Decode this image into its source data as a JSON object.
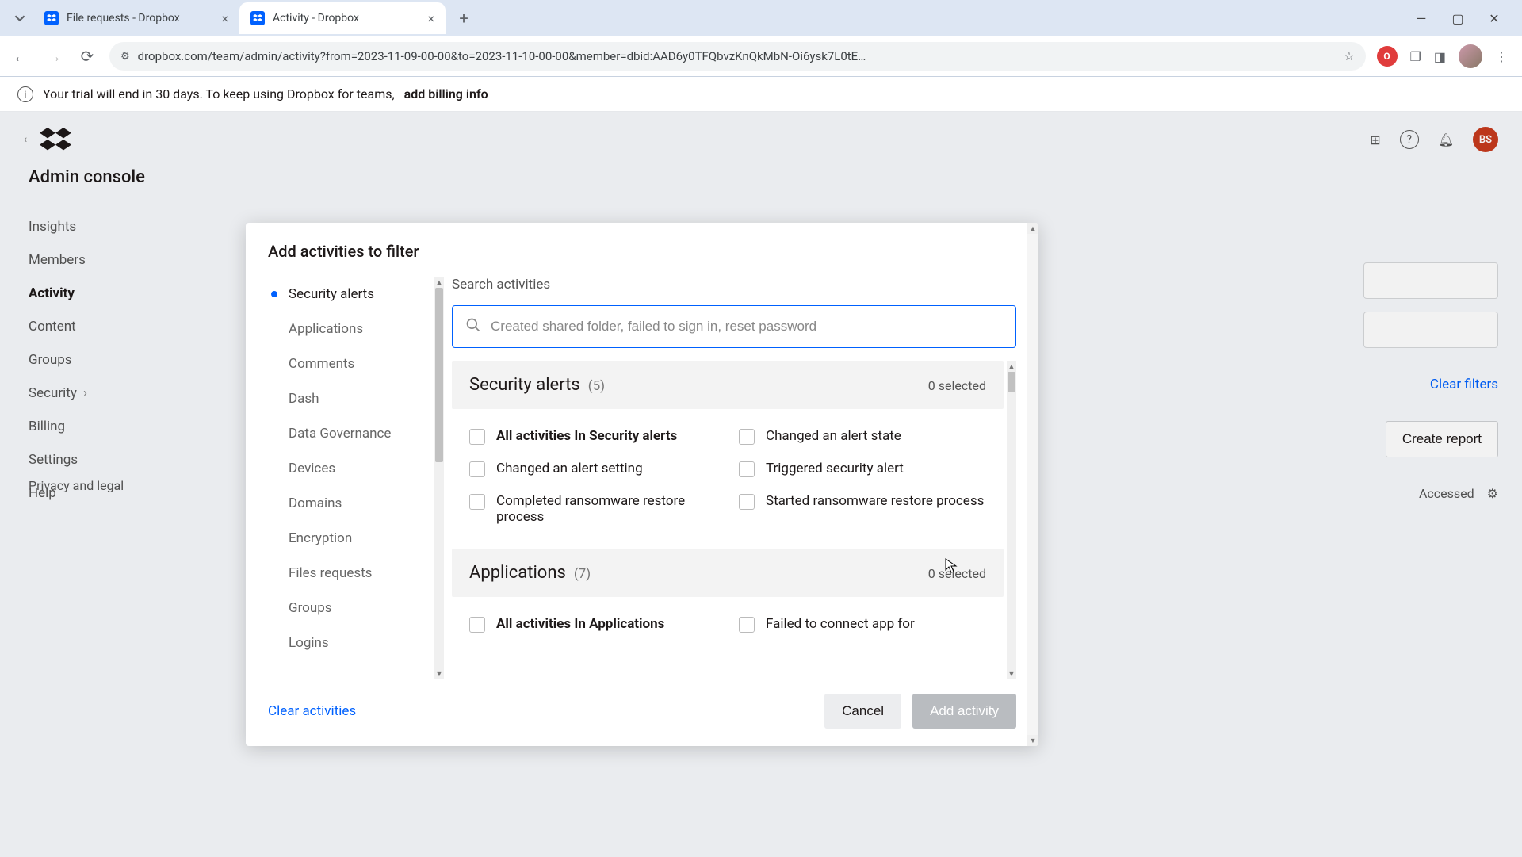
{
  "tabs": [
    {
      "title": "File requests - Dropbox",
      "active": false
    },
    {
      "title": "Activity - Dropbox",
      "active": true
    }
  ],
  "url": "dropbox.com/team/admin/activity?from=2023-11-09-00-00&to=2023-11-10-00-00&member=dbid:AAD6y0TFQbvzKnQkMbN-Oi6ysk7L0tE…",
  "banner": {
    "text": "Your trial will end in 30 days. To keep using Dropbox for teams, ",
    "cta": "add billing info"
  },
  "sidebar": {
    "title": "Admin console",
    "items": [
      "Insights",
      "Members",
      "Activity",
      "Content",
      "Groups",
      "Security",
      "Billing",
      "Settings",
      "Help"
    ],
    "active": "Activity",
    "footer": "Privacy and legal"
  },
  "header_avatar": "BS",
  "right": {
    "clear_filters": "Clear filters",
    "create_report": "Create report",
    "accessed": "Accessed"
  },
  "modal": {
    "title": "Add activities to filter",
    "search_label": "Search activities",
    "search_placeholder": "Created shared folder, failed to sign in, reset password",
    "categories": [
      "Security alerts",
      "Applications",
      "Comments",
      "Dash",
      "Data Governance",
      "Devices",
      "Domains",
      "Encryption",
      "Files requests",
      "Groups",
      "Logins"
    ],
    "selected_category": "Security alerts",
    "sections": [
      {
        "title": "Security alerts",
        "count": "(5)",
        "selected": "0 selected",
        "items_left": [
          "All activities In Security alerts",
          "Changed an alert setting",
          "Completed ransomware restore process"
        ],
        "items_right": [
          "Changed an alert state",
          "Triggered security alert",
          "Started ransomware restore process"
        ]
      },
      {
        "title": "Applications",
        "count": "(7)",
        "selected": "0 selected",
        "items_left": [
          "All activities In Applications"
        ],
        "items_right": [
          "Failed to connect app for"
        ]
      }
    ],
    "footer": {
      "clear": "Clear activities",
      "cancel": "Cancel",
      "add": "Add activity"
    }
  }
}
